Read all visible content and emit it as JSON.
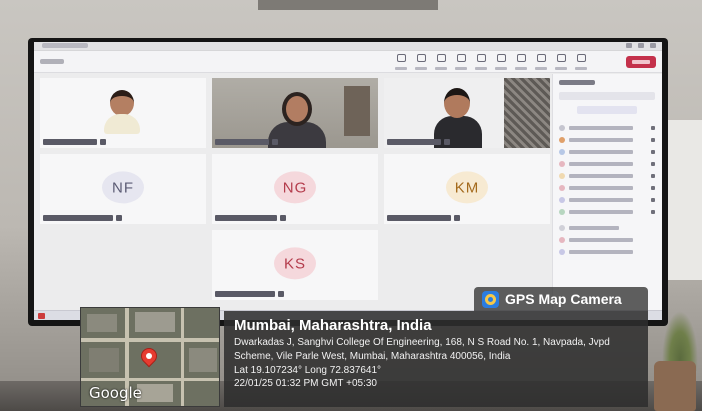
{
  "meeting": {
    "participants": [
      {
        "initials": "",
        "kind": "photo"
      },
      {
        "initials": "",
        "kind": "photo"
      },
      {
        "initials": "",
        "kind": "photo"
      },
      {
        "initials": "NF",
        "kind": "avatar"
      },
      {
        "initials": "NG",
        "kind": "avatar"
      },
      {
        "initials": "KM",
        "kind": "avatar"
      },
      {
        "initials": "KS",
        "kind": "avatar"
      }
    ]
  },
  "gps": {
    "badge_label": "GPS Map Camera",
    "location_title": "Mumbai, Maharashtra, India",
    "address": "Dwarkadas J, Sanghvi College Of Engineering, 168, N S Road No. 1, Navpada, Jvpd Scheme, Vile Parle West, Mumbai, Maharashtra 400056, India",
    "coordinates": "Lat 19.107234° Long 72.837641°",
    "timestamp": "22/01/25 01:32 PM GMT +05:30",
    "map_provider": "Google"
  },
  "colors": {
    "avatar_nf": "#e6e6f0",
    "avatar_ng": "#f5d8dc",
    "avatar_km": "#f7ead2",
    "avatar_ks": "#f5d8dc",
    "leave_button": "#c4314b",
    "map_pin": "#e63b30"
  },
  "icons": [
    "gps-map-camera-logo-icon",
    "map-pin-icon",
    "leave-call-icon"
  ]
}
